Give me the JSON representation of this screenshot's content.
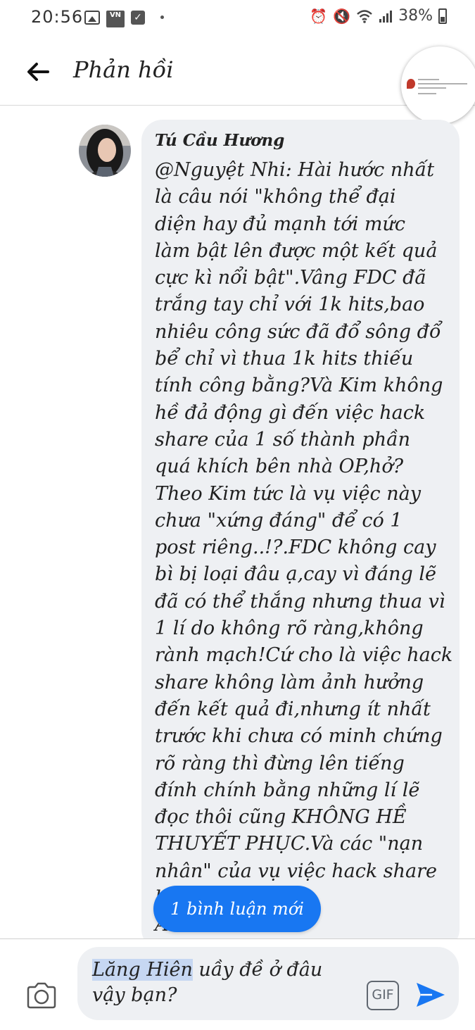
{
  "status_bar": {
    "time": "20:56",
    "vn_badge": "VN",
    "battery": "38%",
    "icons": [
      "image-icon",
      "vn-app-icon",
      "check-icon",
      "dot-icon",
      "alarm-icon",
      "mute-icon",
      "wifi-icon",
      "signal-icon",
      "battery-icon"
    ]
  },
  "header": {
    "title": "Phản hồi"
  },
  "comment": {
    "author": "Tú Cầu Hương",
    "text": "@Nguyệt Nhi: Hài hước nhất\nlà câu nói  \"không thể đại\ndiện hay đủ mạnh tới mức\nlàm bật lên được một kết quả\ncực kì nổi bật\".Vâng FDC đã\ntrắng tay chỉ với 1k hits,bao\nnhiêu công sức đã đổ sông đổ\nbể chỉ vì thua 1k hits thiếu\ntính công bằng?Và Kim không\nhề đả động gì đến việc hack\nshare của 1 số thành phần\nquá khích bên nhà OP,hở?\nTheo Kim tức là vụ việc này\nchưa \"xứng đáng\" để có 1\npost riêng..!?.FDC không cay\nbì bị loại đâu ạ,cay vì đáng lẽ\nđã có thể thắng nhưng thua vì\n1 lí do không rõ ràng,không\nrành mạch!Cứ cho là việc hack\nshare không làm ảnh hưởng\nđến kết quả đi,nhưng ít nhất\ntrước khi chưa có minh chứng\nrõ ràng thì đừng lên tiếng\nđính chính bằng những lí lẽ\nđọc thôi cũng KHÔNG HỀ\nTHUYẾT PHỤC.Và các \"nạn\nnhân\" của vụ việc hack share\n                               họ?Nếu hôm\n                               Ao no"
  },
  "new_comments_pill": "1 bình luận mới",
  "composer": {
    "mention": "Lăng Hiên",
    "text": " uầy đề ở đâu vậy bạn?",
    "gif_label": "GIF"
  },
  "colors": {
    "accent": "#1877f2",
    "bubble": "#eef0f3",
    "mention_highlight": "#c6d7f2"
  }
}
